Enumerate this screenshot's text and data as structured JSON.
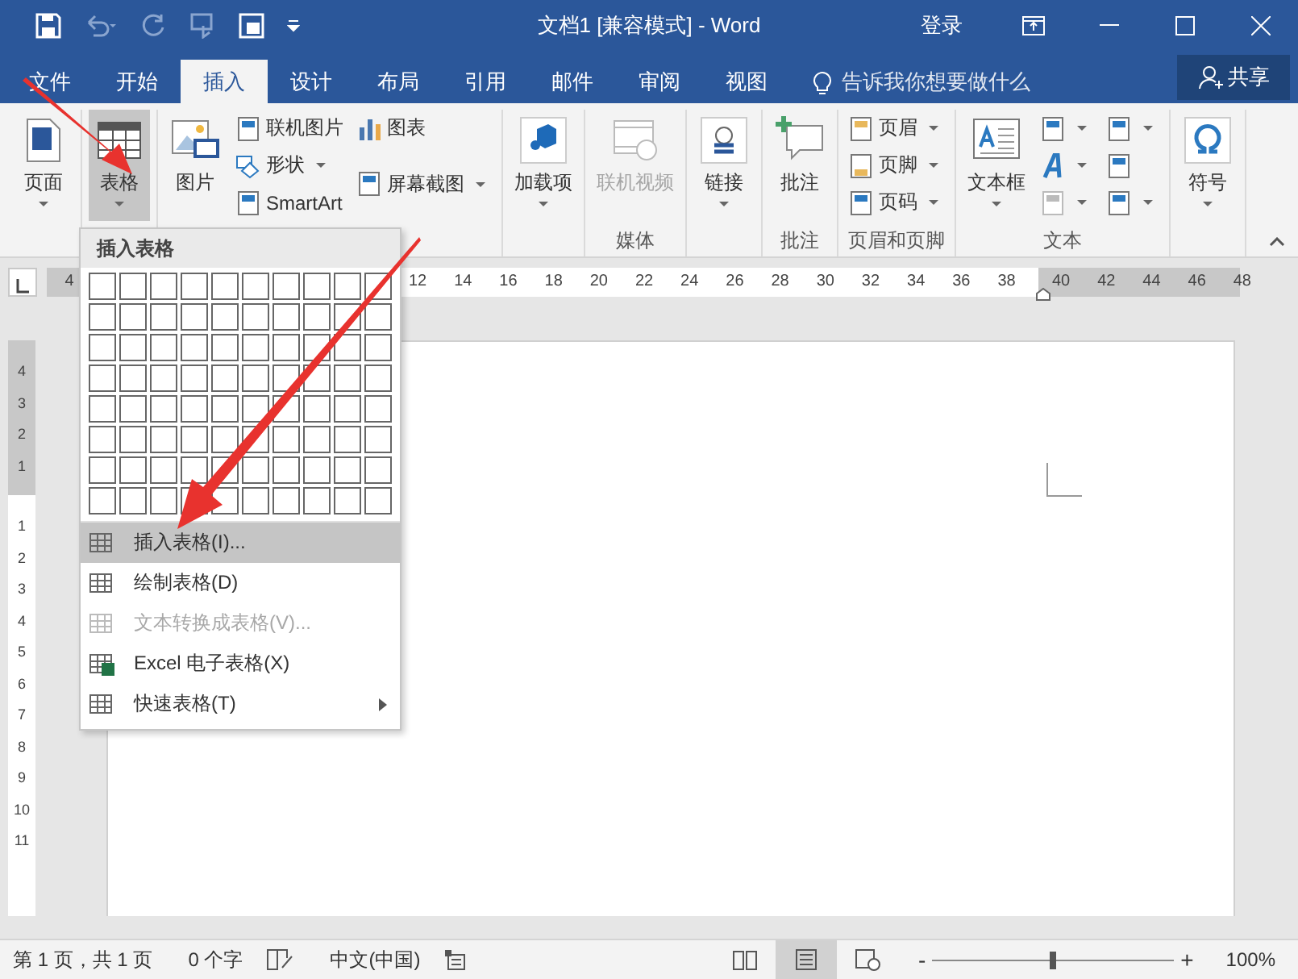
{
  "title_bar": {
    "title": "文档1 [兼容模式] - Word",
    "sign_in": "登录"
  },
  "tabs": [
    {
      "label": "文件",
      "selected": false
    },
    {
      "label": "开始",
      "selected": false
    },
    {
      "label": "插入",
      "selected": true
    },
    {
      "label": "设计",
      "selected": false
    },
    {
      "label": "布局",
      "selected": false
    },
    {
      "label": "引用",
      "selected": false
    },
    {
      "label": "邮件",
      "selected": false
    },
    {
      "label": "审阅",
      "selected": false
    },
    {
      "label": "视图",
      "selected": false
    }
  ],
  "tell_me": {
    "placeholder": "告诉我你想要做什么"
  },
  "share": {
    "label": "共享"
  },
  "ribbon": {
    "groups": [
      {
        "buttons": [
          {
            "kind": "big",
            "label": "页面",
            "menu": true,
            "selected": false
          }
        ]
      },
      {
        "buttons": [
          {
            "kind": "big",
            "label": "表格",
            "menu": true,
            "selected": true
          }
        ]
      },
      {
        "buttons": [
          {
            "kind": "big",
            "label": "图片",
            "menu": false,
            "selected": false
          },
          {
            "kind": "small",
            "label": "联机图片",
            "menu": false
          },
          {
            "kind": "small",
            "label": "形状",
            "menu": true
          },
          {
            "kind": "small",
            "label": "SmartArt",
            "menu": false
          },
          {
            "kind": "small",
            "label": "图表",
            "menu": false
          },
          {
            "kind": "small",
            "label": "屏幕截图",
            "menu": true
          }
        ]
      },
      {
        "buttons": [
          {
            "kind": "big",
            "label": "加载项",
            "menu": true,
            "selected": false
          }
        ]
      },
      {
        "label": "媒体",
        "buttons": [
          {
            "kind": "big",
            "label": "联机视频",
            "menu": false,
            "selected": false,
            "disabled": true
          }
        ]
      },
      {
        "buttons": [
          {
            "kind": "big",
            "label": "链接",
            "menu": true,
            "selected": false
          }
        ]
      },
      {
        "label": "批注",
        "buttons": [
          {
            "kind": "big",
            "label": "批注",
            "menu": false,
            "selected": false
          }
        ]
      },
      {
        "label": "页眉和页脚",
        "buttons": [
          {
            "kind": "small",
            "label": "页眉",
            "menu": true
          },
          {
            "kind": "small",
            "label": "页脚",
            "menu": true
          },
          {
            "kind": "small",
            "label": "页码",
            "menu": true
          }
        ]
      },
      {
        "label": "文本",
        "buttons": [
          {
            "kind": "big",
            "label": "文本框",
            "menu": true,
            "selected": false
          },
          {
            "kind": "icon",
            "menu": true,
            "disabled": false
          },
          {
            "kind": "icon",
            "menu": true,
            "disabled": false
          },
          {
            "kind": "icon",
            "menu": true,
            "disabled": true
          },
          {
            "kind": "icon",
            "menu": true,
            "disabled": false
          },
          {
            "kind": "icon",
            "menu": false,
            "disabled": false
          },
          {
            "kind": "icon",
            "menu": true,
            "disabled": false
          }
        ]
      },
      {
        "buttons": [
          {
            "kind": "big",
            "label": "符号",
            "menu": true,
            "selected": false
          }
        ]
      }
    ]
  },
  "ruler": {
    "left_labels": [
      "4"
    ],
    "body_labels": [
      "12",
      "14",
      "16",
      "18",
      "20",
      "22",
      "24",
      "26",
      "28",
      "30",
      "32",
      "34",
      "36",
      "38"
    ],
    "right_labels": [
      "40",
      "42",
      "44",
      "46",
      "48"
    ]
  },
  "vertical_ruler": {
    "top_labels": [
      "4",
      "3",
      "2",
      "1"
    ],
    "body_labels": [
      "1",
      "2",
      "3",
      "4",
      "5",
      "6",
      "7",
      "8",
      "9",
      "10",
      "11"
    ]
  },
  "table_menu": {
    "title": "插入表格",
    "items": [
      {
        "label": "插入表格(I)...",
        "selected": true,
        "disabled": false,
        "submenu": false
      },
      {
        "label": "绘制表格(D)",
        "selected": false,
        "disabled": false,
        "submenu": false
      },
      {
        "label": "文本转换成表格(V)...",
        "selected": false,
        "disabled": true,
        "submenu": false
      },
      {
        "label": "Excel 电子表格(X)",
        "selected": false,
        "disabled": false,
        "submenu": false
      },
      {
        "label": "快速表格(T)",
        "selected": false,
        "disabled": false,
        "submenu": true
      }
    ]
  },
  "status_bar": {
    "page": "第 1 页，共 1 页",
    "words": "0 个字",
    "language": "中文(中国)",
    "views": [
      {
        "selected": false
      },
      {
        "selected": true
      },
      {
        "selected": false
      }
    ],
    "zoom": {
      "minus": "-",
      "plus": "+",
      "level": 0.5,
      "percent": "100%"
    }
  }
}
